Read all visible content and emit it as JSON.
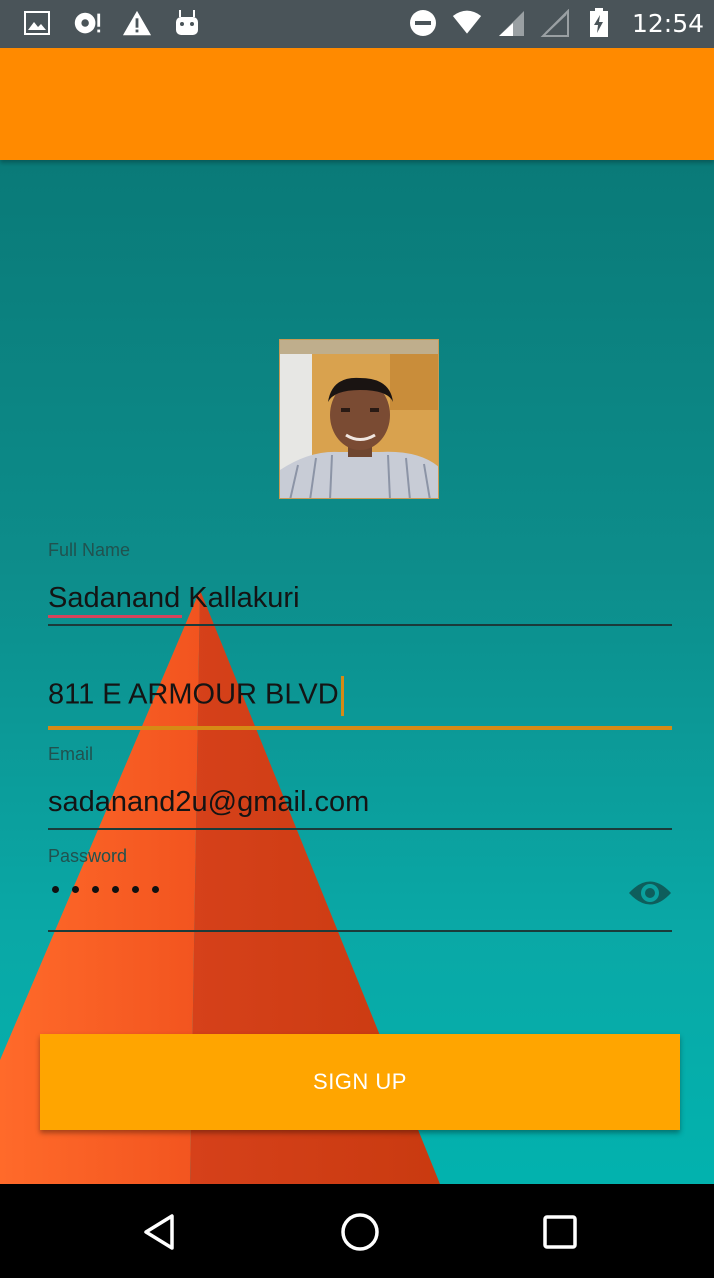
{
  "status_bar": {
    "time": "12:54",
    "icons": [
      "image-icon",
      "sync-icon",
      "warning-icon",
      "android-icon",
      "do-not-disturb-icon",
      "wifi-icon",
      "signal-icon",
      "signal-empty-icon",
      "battery-charging-icon"
    ]
  },
  "profile": {
    "avatar_icon": "profile-photo"
  },
  "form": {
    "full_name": {
      "label": "Full Name",
      "value": "Sadanand Kallakuri"
    },
    "address": {
      "value": "811 E ARMOUR BLVD"
    },
    "email": {
      "label": "Email",
      "value": "sadanand2u@gmail.com"
    },
    "password": {
      "label": "Password",
      "masked_length": 6,
      "toggle_icon": "eye-icon"
    }
  },
  "signup_button": {
    "label": "SIGN UP"
  },
  "colors": {
    "app_bar": "#ff8a00",
    "button": "#ffa500",
    "accent_line": "#d68a15",
    "background_teal": "#0a8e8c",
    "triangle": "#e8461a"
  },
  "nav_bar": {
    "buttons": [
      "back-icon",
      "home-icon",
      "recents-icon"
    ]
  }
}
